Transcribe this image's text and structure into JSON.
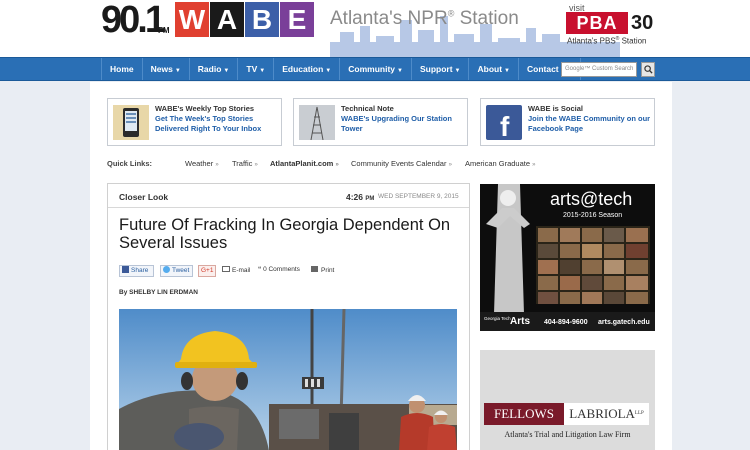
{
  "header": {
    "logo_number": "90.1",
    "logo_fm": "FM",
    "logo_letters": [
      "W",
      "A",
      "B",
      "E"
    ],
    "logo_colors": [
      "#e04030",
      "#1a1a1a",
      "#3c5fa8",
      "#7a3f99"
    ],
    "tagline": "Atlanta's NPR",
    "tagline_mark": "®",
    "tagline_end": " Station",
    "visit_label": "visit",
    "pba_label": "PBA",
    "pba_number": "30",
    "pba_sub": "Atlanta's PBS",
    "pba_sub_mark": "®",
    "pba_sub_end": " Station"
  },
  "nav": {
    "items": [
      {
        "label": "Home",
        "dropdown": false
      },
      {
        "label": "News",
        "dropdown": true
      },
      {
        "label": "Radio",
        "dropdown": true
      },
      {
        "label": "TV",
        "dropdown": true
      },
      {
        "label": "Education",
        "dropdown": true
      },
      {
        "label": "Community",
        "dropdown": true
      },
      {
        "label": "Support",
        "dropdown": true
      },
      {
        "label": "About",
        "dropdown": true
      },
      {
        "label": "Contact Us",
        "dropdown": false
      }
    ],
    "search_placeholder": "Google™ Custom Search",
    "search_icon": "search-icon"
  },
  "promos": [
    {
      "title": "WABE's Weekly Top Stories",
      "text": "Get The Week's Top Stories Delivered Right To Your Inbox",
      "icon": "phone-icon"
    },
    {
      "title": "Technical Note",
      "text": "WABE's Upgrading Our Station Tower",
      "icon": "tower-icon"
    },
    {
      "title": "WABE is Social",
      "text": "Join the WABE Community on our Facebook Page",
      "icon": "facebook-icon"
    }
  ],
  "quick_links": {
    "label": "Quick Links:",
    "items": [
      "Weather",
      "Traffic",
      "AtlantaPlanit.com",
      "Community Events Calendar",
      "American Graduate"
    ]
  },
  "article": {
    "section": "Closer Look",
    "time": "4:26",
    "time_suffix": "PM",
    "date": "WED SEPTEMBER 9, 2015",
    "headline": "Future Of Fracking In Georgia Dependent On Several Issues",
    "share": {
      "share_label": "Share",
      "tweet_label": "Tweet",
      "gplus_label": "G+1",
      "email_label": "E-mail",
      "comments_label": "0 Comments",
      "print_label": "Print"
    },
    "byline": "By SHELBY LIN ERDMAN"
  },
  "ads": {
    "arts_title": "arts@tech",
    "arts_season": "2015-2016 Season",
    "arts_brand_small": "Georgia Tech",
    "arts_brand": "Arts",
    "arts_phone": "404-894-9600",
    "arts_url": "arts.gatech.edu",
    "law_left": "FELLOWS",
    "law_right": "LABRIOLA",
    "law_llp": "LLP",
    "law_tagline": "Atlanta's Trial and Litigation Law Firm"
  }
}
